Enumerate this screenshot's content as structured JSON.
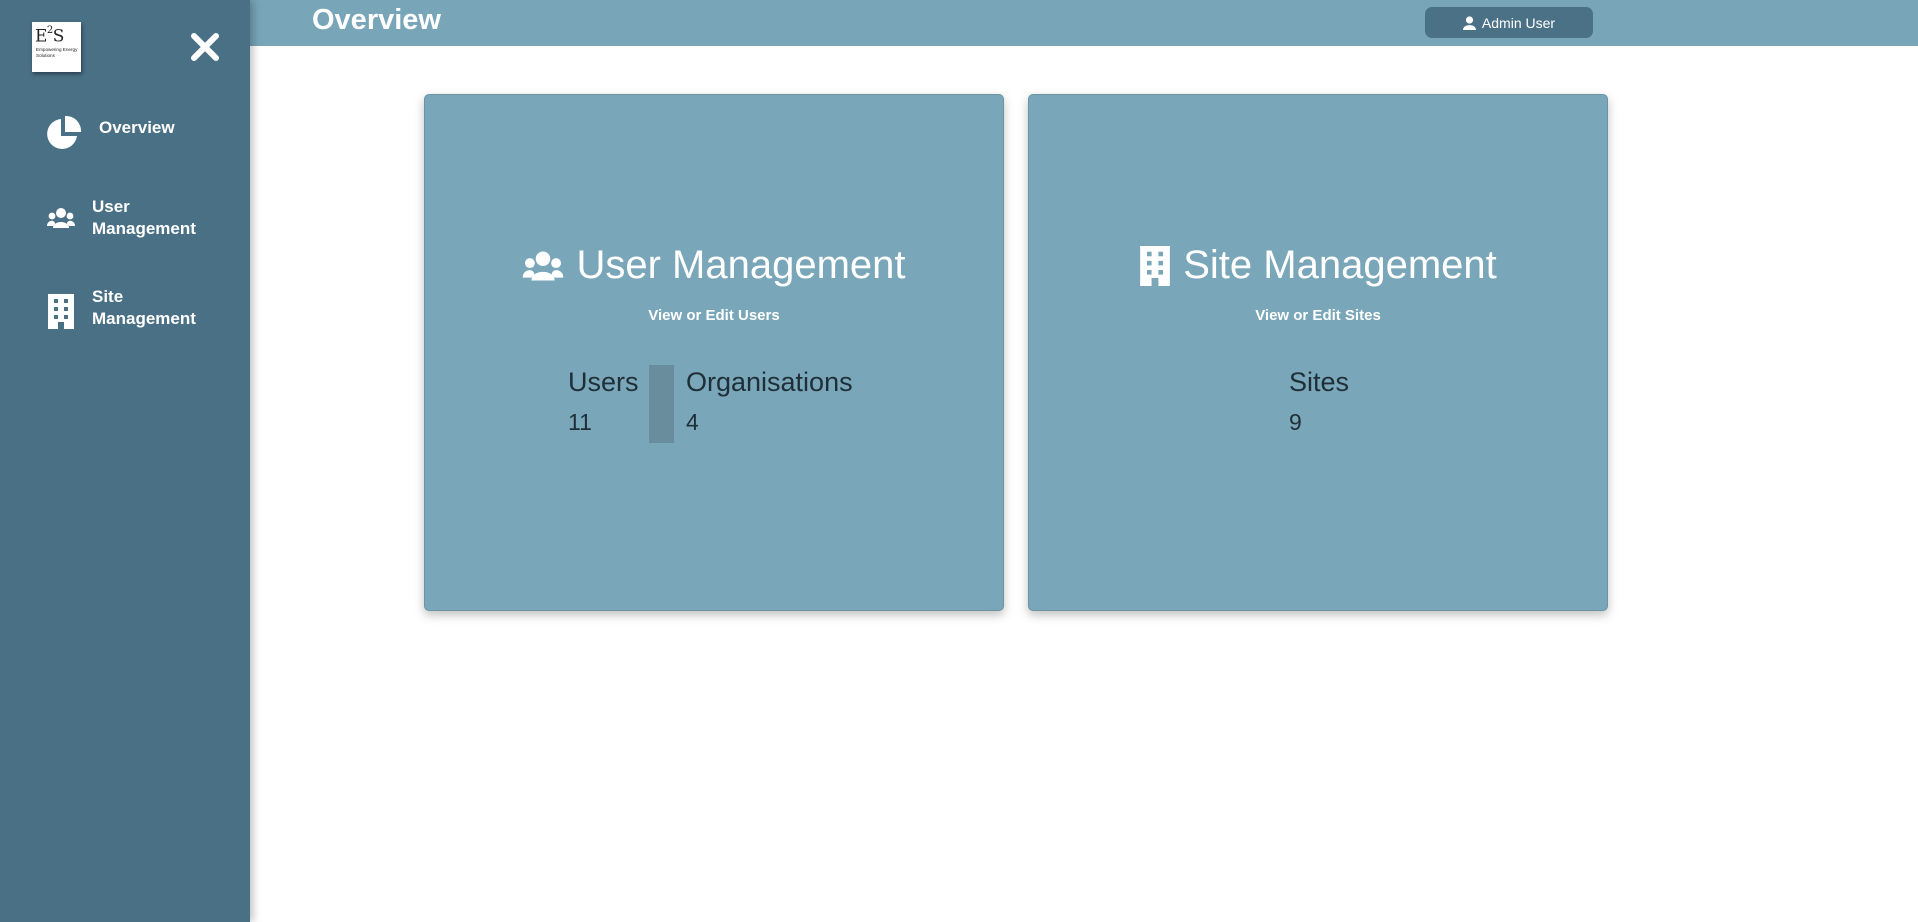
{
  "header": {
    "title": "Overview",
    "user_button": "Admin User"
  },
  "logo": {
    "mark": "E",
    "mark_sup": "2",
    "mark_end": "S",
    "tagline": "Empowering Energy Solutions"
  },
  "sidebar": {
    "items": [
      {
        "label": "Overview",
        "icon": "pie-chart-icon"
      },
      {
        "label": "User\nManagement",
        "icon": "users-icon"
      },
      {
        "label": "Site\nManagement",
        "icon": "building-icon"
      }
    ]
  },
  "cards": {
    "users": {
      "title": "User Management",
      "subtitle": "View or Edit Users",
      "stats": [
        {
          "label": "Users",
          "value": "11"
        },
        {
          "label": "Organisations",
          "value": "4"
        }
      ]
    },
    "sites": {
      "title": "Site Management",
      "subtitle": "View or Edit Sites",
      "stats": [
        {
          "label": "Sites",
          "value": "9"
        }
      ]
    }
  },
  "colors": {
    "sidebar": "#4a7085",
    "header": "#78a6b8",
    "card": "#79a6b8",
    "user_button": "#4b7186"
  }
}
